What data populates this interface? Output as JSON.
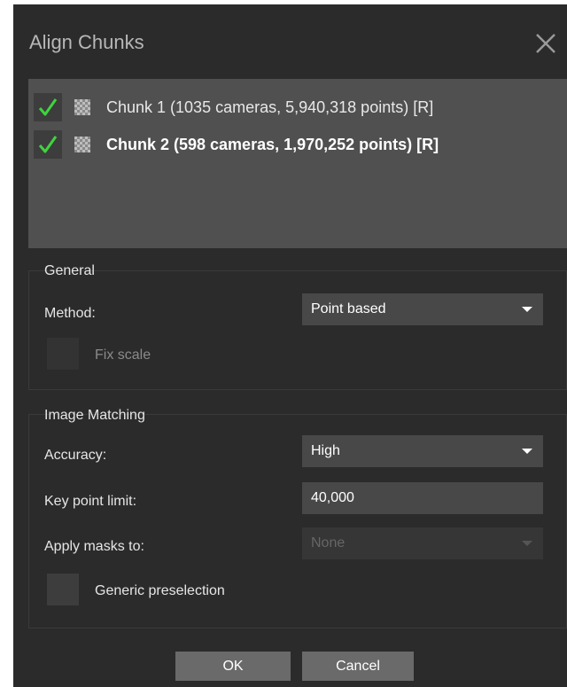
{
  "dialog": {
    "title": "Align Chunks",
    "close_icon": "close-icon"
  },
  "chunks": [
    {
      "label": "Chunk 1 (1035 cameras, 5,940,318 points) [R]",
      "checked": true,
      "bold": false,
      "icon": "chunk-grid-icon"
    },
    {
      "label": "Chunk 2 (598 cameras, 1,970,252 points) [R]",
      "checked": true,
      "bold": true,
      "icon": "chunk-grid-icon"
    }
  ],
  "general": {
    "title": "General",
    "method_label": "Method:",
    "method_value": "Point based",
    "fix_scale_label": "Fix scale",
    "fix_scale_checked": false,
    "fix_scale_enabled": false
  },
  "image_matching": {
    "title": "Image Matching",
    "accuracy_label": "Accuracy:",
    "accuracy_value": "High",
    "key_point_limit_label": "Key point limit:",
    "key_point_limit_value": "40,000",
    "apply_masks_label": "Apply masks to:",
    "apply_masks_value": "None",
    "apply_masks_enabled": false,
    "generic_preselection_label": "Generic preselection",
    "generic_preselection_checked": false
  },
  "buttons": {
    "ok": "OK",
    "cancel": "Cancel"
  },
  "colors": {
    "dialog_bg": "#2b2b2b",
    "list_bg": "#505050",
    "check_green": "#3fd33f",
    "button_bg": "#6a6a6a"
  }
}
